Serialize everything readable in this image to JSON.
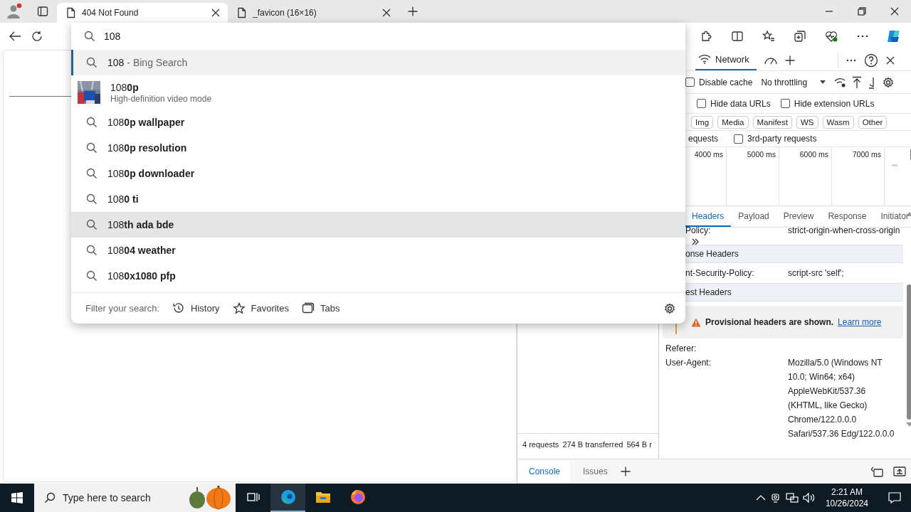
{
  "browser": {
    "tabs": [
      {
        "title": "404 Not Found",
        "selected": true
      },
      {
        "title": "_favicon (16×16)",
        "selected": false
      }
    ]
  },
  "omnibox": {
    "value": "108",
    "suggestions": [
      {
        "kind": "search",
        "text": "108",
        "note": "- Bing Search",
        "selected": true,
        "hovered": false
      },
      {
        "kind": "entity",
        "text": "108**0p**",
        "subtitle": "High-definition video mode",
        "selected": false,
        "hovered": false
      },
      {
        "kind": "search",
        "text": "108**0p wallpaper**",
        "selected": false,
        "hovered": false
      },
      {
        "kind": "search",
        "text": "108**0p resolution**",
        "selected": false,
        "hovered": false
      },
      {
        "kind": "search",
        "text": "108**0p downloader**",
        "selected": false,
        "hovered": false
      },
      {
        "kind": "search",
        "text": "108**0 ti**",
        "selected": false,
        "hovered": false
      },
      {
        "kind": "search",
        "text": "108**th ada bde**",
        "selected": false,
        "hovered": true
      },
      {
        "kind": "search",
        "text": "108**04 weather**",
        "selected": false,
        "hovered": false
      },
      {
        "kind": "search",
        "text": "108**0x1080 pfp**",
        "selected": false,
        "hovered": false
      }
    ],
    "filter": {
      "label": "Filter your search:",
      "options": [
        {
          "kind": "history",
          "label": "History"
        },
        {
          "kind": "favorites",
          "label": "Favorites"
        },
        {
          "kind": "tabs",
          "label": "Tabs"
        }
      ]
    }
  },
  "devtools": {
    "panels": [
      {
        "label": "Network",
        "selected": true
      }
    ],
    "toolbar": {
      "disable_cache": {
        "label": "Disable cache",
        "checked": false
      },
      "throttling": "No throttling"
    },
    "filters": {
      "checkboxes": [
        {
          "label": "Hide data URLs",
          "checked": false
        },
        {
          "label": "Hide extension URLs",
          "checked": false
        }
      ],
      "types": [
        {
          "label": "Img",
          "selected": false
        },
        {
          "label": "Media",
          "selected": false
        },
        {
          "label": "Manifest",
          "selected": false
        },
        {
          "label": "WS",
          "selected": false
        },
        {
          "label": "Wasm",
          "selected": false
        },
        {
          "label": "Other",
          "selected": false
        }
      ],
      "cut_label": "equests",
      "third_party": {
        "label": "3rd-party requests",
        "checked": false
      }
    },
    "timeline": {
      "ticks": [
        "4000 ms",
        "5000 ms",
        "6000 ms",
        "7000 ms"
      ]
    },
    "summary": [
      "4 requests",
      "274 B transferred",
      "564 B r"
    ],
    "details": {
      "tabs": [
        {
          "label": "Headers",
          "selected": true
        },
        {
          "label": "Payload",
          "selected": false
        },
        {
          "label": "Preview",
          "selected": false
        },
        {
          "label": "Response",
          "selected": false
        },
        {
          "label": "Initiator",
          "selected": false
        }
      ],
      "rows": [
        {
          "kind": "header",
          "name": "Policy:",
          "value": "strict-origin-when-cross-origin",
          "partial": true
        },
        {
          "kind": "section",
          "title": "onse Headers"
        },
        {
          "kind": "header",
          "name": "nt-Security-Policy:",
          "value": "script-src 'self';",
          "partial": true
        },
        {
          "kind": "section",
          "title": "est Headers"
        },
        {
          "kind": "warning",
          "text": "Provisional headers are shown.",
          "link": "Learn more"
        },
        {
          "kind": "header",
          "name": "Referer:",
          "partial": false
        },
        {
          "kind": "header",
          "name": "User-Agent:",
          "value": "Mozilla/5.0 (Windows NT 10.0; Win64; x64) AppleWebKit/537.36 (KHTML, like Gecko) Chrome/122.0.0.0 Safari/537.36 Edg/122.0.0.0",
          "partial": false
        }
      ]
    },
    "drawer": {
      "tabs": [
        {
          "label": "Console",
          "selected": true
        },
        {
          "label": "Issues",
          "selected": false
        }
      ]
    }
  },
  "taskbar": {
    "search_placeholder": "Type here to search",
    "apps": [
      {
        "kind": "taskview",
        "active": false
      },
      {
        "kind": "edge",
        "active": true
      },
      {
        "kind": "explorer",
        "active": false
      },
      {
        "kind": "firefox",
        "active": false
      }
    ],
    "time": "2:21 AM",
    "date": "10/26/2024"
  }
}
